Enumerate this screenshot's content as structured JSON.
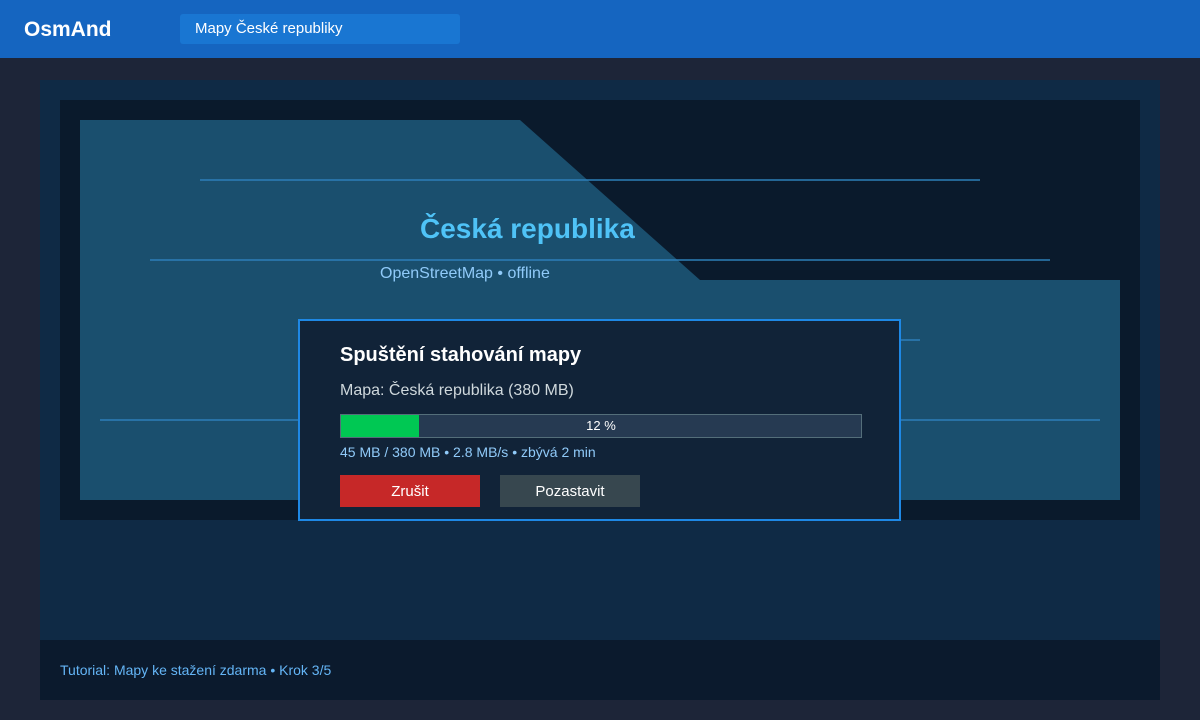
{
  "app": {
    "title": "OsmAnd",
    "tab_label": "Mapy České republiky"
  },
  "hero": {
    "title": "Česká republika",
    "subtitle": "OpenStreetMap • offline"
  },
  "dialog": {
    "title": "Spuštění stahování mapy",
    "map_label": "Mapa: Česká republika (380 MB)",
    "progress_percent": 12,
    "progress_text": "12 %",
    "stats": "45 MB / 380 MB • 2.8 MB/s • zbývá 2 min",
    "cancel_label": "Zrušit",
    "pause_label": "Pozastavit"
  },
  "footer": {
    "text": "Tutorial: Mapy ke stažení zdarma • Krok 3/5"
  },
  "colors": {
    "topbar": "#1565c0",
    "tab": "#1976d2",
    "accent_title": "#4fc3f7",
    "progress_fill": "#00c853",
    "cancel": "#c62828",
    "pause": "#37474f",
    "dialog_border": "#1e88e5"
  }
}
